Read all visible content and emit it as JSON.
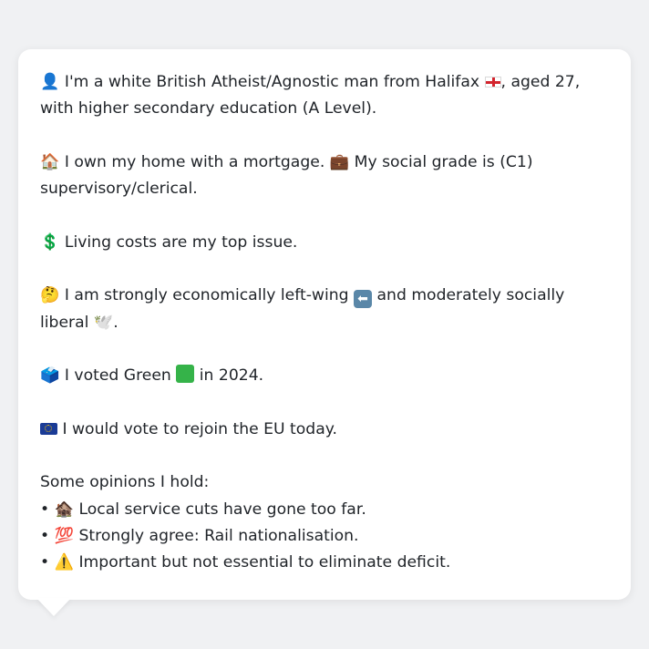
{
  "profile": {
    "line1_pre": "I'm a white British Atheist/Agnostic man from Halifax",
    "line1_post": ", aged 27, with higher secondary education (A Level).",
    "line2_a": "I own my home with a mortgage.",
    "line2_b": "My social grade is (C1) supervisory/clerical.",
    "line3": "Living costs are my top issue.",
    "line4_a": "I am strongly economically left-wing",
    "line4_b": "and moderately socially liberal",
    "line4_end": ".",
    "line5_a": "I voted Green",
    "line5_b": "in 2024.",
    "line6": "I would vote to rejoin the EU today.",
    "opinions_title": "Some opinions I hold:",
    "bullet": "•",
    "opinions": [
      "Local service cuts have gone too far.",
      "Strongly agree: Rail nationalisation.",
      "Important but not essential to eliminate deficit."
    ]
  },
  "icons": {
    "person": "👤",
    "house": "🏠",
    "briefcase": "💼",
    "dollar": "💲",
    "thinking": "🤔",
    "left_arrow": "⬅",
    "dove": "🕊️",
    "ballot": "🗳️",
    "derelict_house": "🏚️",
    "hundred": "💯",
    "warning": "⚠️"
  },
  "colors": {
    "background": "#f0f1f3",
    "card": "#ffffff",
    "text": "#1f2328",
    "green": "#35b349"
  }
}
